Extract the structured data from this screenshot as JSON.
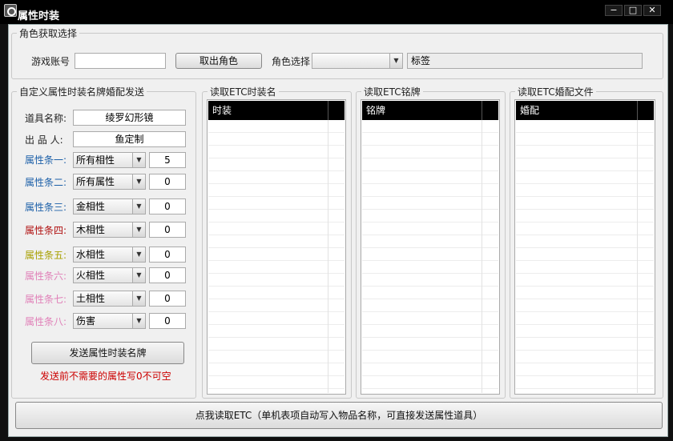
{
  "window": {
    "title": "属性时装"
  },
  "role_panel": {
    "legend": "角色获取选择",
    "account_label": "游戏账号",
    "account_value": "",
    "fetch_button": "取出角色",
    "role_select_label": "角色选择",
    "role_select_value": "",
    "tag_value": "标签"
  },
  "custom_panel": {
    "legend": "自定义属性时装名牌婚配发送",
    "item_name_label": "道具名称:",
    "item_name_value": "绫罗幻形镜",
    "producer_label": "出 品 人:",
    "producer_value": "鱼定制",
    "attributes": [
      {
        "label": "属性条一:",
        "color": "#1b5fa8",
        "option": "所有相性",
        "value": "5"
      },
      {
        "label": "属性条二:",
        "color": "#1b5fa8",
        "option": "所有属性",
        "value": "0"
      },
      {
        "label": "属性条三:",
        "color": "#1b5fa8",
        "option": "金相性",
        "value": "0"
      },
      {
        "label": "属性条四:",
        "color": "#b01010",
        "option": "木相性",
        "value": "0"
      },
      {
        "label": "属性条五:",
        "color": "#a8a000",
        "option": "水相性",
        "value": "0"
      },
      {
        "label": "属性条六:",
        "color": "#e080b8",
        "option": "火相性",
        "value": "0"
      },
      {
        "label": "属性条七:",
        "color": "#e080b8",
        "option": "土相性",
        "value": "0"
      },
      {
        "label": "属性条八:",
        "color": "#e080b8",
        "option": "伤害",
        "value": "0"
      }
    ],
    "send_button": "发送属性时装名牌",
    "note": "发送前不需要的属性写0不可空"
  },
  "lists": [
    {
      "legend": "读取ETC时装名",
      "header": "时装"
    },
    {
      "legend": "读取ETC铭牌",
      "header": "铭牌"
    },
    {
      "legend": "读取ETC婚配文件",
      "header": "婚配"
    }
  ],
  "read_etc_button": "点我读取ETC（单机表项自动写入物品名称，可直接发送属性道具）"
}
